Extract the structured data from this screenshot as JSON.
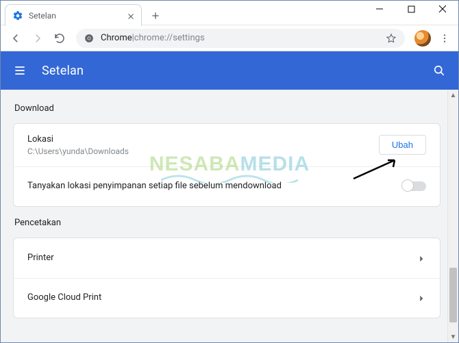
{
  "window": {
    "tab_title": "Setelan"
  },
  "omnibox": {
    "prefix": "Chrome",
    "separator": " | ",
    "url": "chrome://settings"
  },
  "header": {
    "title": "Setelan"
  },
  "sections": {
    "download": {
      "title": "Download",
      "location_label": "Lokasi",
      "location_value": "C:\\Users\\yunda\\Downloads",
      "change_button": "Ubah",
      "ask_toggle_label": "Tanyakan lokasi penyimpanan setiap file sebelum mendownload"
    },
    "printing": {
      "title": "Pencetakan",
      "items": [
        {
          "label": "Printer"
        },
        {
          "label": "Google Cloud Print"
        }
      ]
    }
  },
  "watermark": {
    "part1": "NESABA",
    "part2": "MEDIA"
  }
}
